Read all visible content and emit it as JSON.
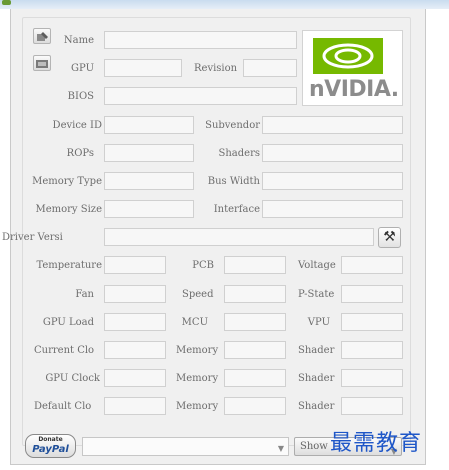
{
  "labels": {
    "name": "Name",
    "gpu": "GPU",
    "revision": "Revision",
    "bios": "BIOS",
    "device_id": "Device ID",
    "subvendor": "Subvendor",
    "rops": "ROPs",
    "shaders": "Shaders",
    "memory_type": "Memory Type",
    "bus_width": "Bus Width",
    "memory_size": "Memory Size",
    "interface": "Interface",
    "driver_version": "Driver Versi",
    "temperature": "Temperature",
    "pcb": "PCB",
    "voltage": "Voltage",
    "fan": "Fan",
    "speed": "Speed",
    "p_state": "P-State",
    "gpu_load": "GPU Load",
    "mcu": "MCU",
    "vpu": "VPU",
    "current_clock": "Current Clo",
    "gpu_clock": "GPU Clock",
    "default_clock": "Default Clo",
    "memory": "Memory",
    "shader": "Shader"
  },
  "logo": {
    "brand": "nVIDIA.",
    "accent_color": "#76b900"
  },
  "buttons": {
    "paypal_top": "Donate",
    "paypal_bottom": "PayPal",
    "show": "Show"
  },
  "watermark": "最需教育",
  "icons": {
    "top_left": "edit-icon",
    "second": "card-icon",
    "tool": "tools-icon"
  }
}
